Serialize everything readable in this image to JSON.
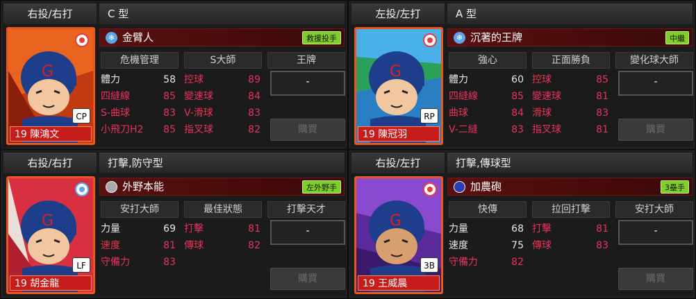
{
  "cards": [
    {
      "hand": "右投/右打",
      "type": "C 型",
      "player_number_name": "19 陳鴻文",
      "position": "CP",
      "skill_icon": "snowflake-icon",
      "skill_name": "金臂人",
      "role_badge": "救援投手",
      "abilities": [
        "危機管理",
        "S大師",
        "王牌"
      ],
      "stats_left": [
        [
          "體力",
          "58"
        ],
        [
          "四縫線",
          "85"
        ],
        [
          "S-曲球",
          "83"
        ],
        [
          "小飛刀H2",
          "85"
        ]
      ],
      "stats_right": [
        [
          "控球",
          "89"
        ],
        [
          "變速球",
          "84"
        ],
        [
          "V-滑球",
          "83"
        ],
        [
          "指叉球",
          "82"
        ]
      ],
      "slot_value": "-",
      "buy_label": "購買"
    },
    {
      "hand": "左投/左打",
      "type": "A 型",
      "player_number_name": "19 陳冠羽",
      "position": "RP",
      "skill_icon": "snowflake-icon",
      "skill_name": "沉著的王牌",
      "role_badge": "中繼",
      "abilities": [
        "強心",
        "正面勝負",
        "變化球大師"
      ],
      "stats_left": [
        [
          "體力",
          "60"
        ],
        [
          "四縫線",
          "85"
        ],
        [
          "曲球",
          "84"
        ],
        [
          "V-二縫",
          "83"
        ]
      ],
      "stats_right": [
        [
          "控球",
          "85"
        ],
        [
          "變速球",
          "81"
        ],
        [
          "滑球",
          "83"
        ],
        [
          "指叉球",
          "81"
        ]
      ],
      "slot_value": "-",
      "buy_label": "購買"
    },
    {
      "hand": "右投/右打",
      "type": "打擊,防守型",
      "player_number_name": "19 胡金龍",
      "position": "LF",
      "skill_icon": "silver-ball-icon",
      "skill_name": "外野本能",
      "role_badge": "左外野手",
      "abilities": [
        "安打大師",
        "最佳狀態",
        "打擊天才"
      ],
      "stats_left": [
        [
          "力量",
          "69"
        ],
        [
          "速度",
          "81"
        ],
        [
          "守備力",
          "83"
        ]
      ],
      "stats_right": [
        [
          "打擊",
          "81"
        ],
        [
          "傳球",
          "82"
        ]
      ],
      "slot_value": "-",
      "buy_label": "購買"
    },
    {
      "hand": "右投/左打",
      "type": "打擊,傳球型",
      "player_number_name": "19 王威晨",
      "position": "3B",
      "skill_icon": "blue-ball-icon",
      "skill_name": "加農砲",
      "role_badge": "3壘手",
      "abilities": [
        "快傳",
        "拉回打擊",
        "安打大師"
      ],
      "stats_left": [
        [
          "力量",
          "68"
        ],
        [
          "速度",
          "75"
        ],
        [
          "守備力",
          "82"
        ]
      ],
      "stats_right": [
        [
          "打擊",
          "81"
        ],
        [
          "傳球",
          "83"
        ]
      ],
      "slot_value": "-",
      "buy_label": "購買"
    }
  ]
}
